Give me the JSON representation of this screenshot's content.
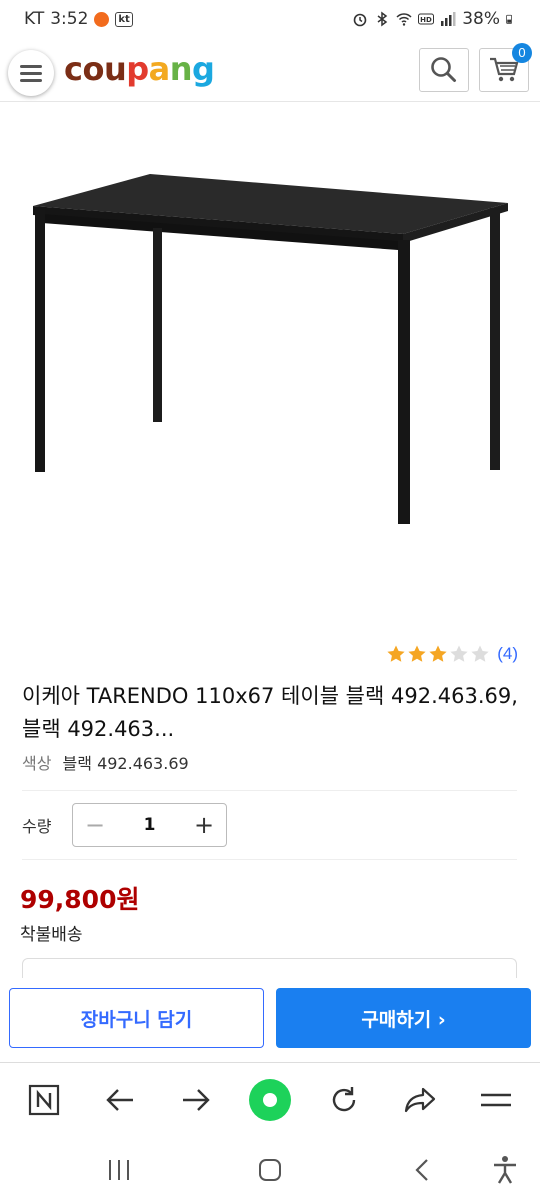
{
  "status_bar": {
    "carrier": "KT",
    "time": "3:52",
    "kt_badge": "kt",
    "battery": "38%"
  },
  "header": {
    "logo_letters": [
      "c",
      "o",
      "u",
      "p",
      "a",
      "n",
      "g"
    ],
    "logo_colors": [
      "#7b2e16",
      "#7b2e16",
      "#7b2e16",
      "#e23b2e",
      "#f3a920",
      "#67b246",
      "#1ba8e0"
    ],
    "cart_count": "0",
    "icons": [
      "menu-icon",
      "search-icon",
      "cart-icon"
    ]
  },
  "product": {
    "rating": 3,
    "rating_max": 5,
    "rating_count": "(4)",
    "title": "이케아 TARENDO 110x67 테이블 블랙 492.463.69, 블랙 492.463...",
    "option_label": "색상",
    "option_value": "블랙 492.463.69",
    "quantity_label": "수량",
    "quantity": "1",
    "price": "99,800원",
    "shipping": "착불배송"
  },
  "actions": {
    "add_to_cart": "장바구니 담기",
    "buy_now": "구매하기 ›"
  },
  "browser_bar": {
    "icons": [
      "naver-n-icon",
      "back-arrow-icon",
      "forward-arrow-icon",
      "green-circle-icon",
      "refresh-icon",
      "share-icon",
      "menu-lines-icon"
    ]
  },
  "system_nav": {
    "icons": [
      "recent-apps-icon",
      "home-icon",
      "back-icon",
      "accessibility-icon"
    ]
  },
  "colors": {
    "accent_blue": "#346aff",
    "buy_blue": "#1a7ff0",
    "price_red": "#ae0000",
    "star_gold": "#f5a623"
  }
}
